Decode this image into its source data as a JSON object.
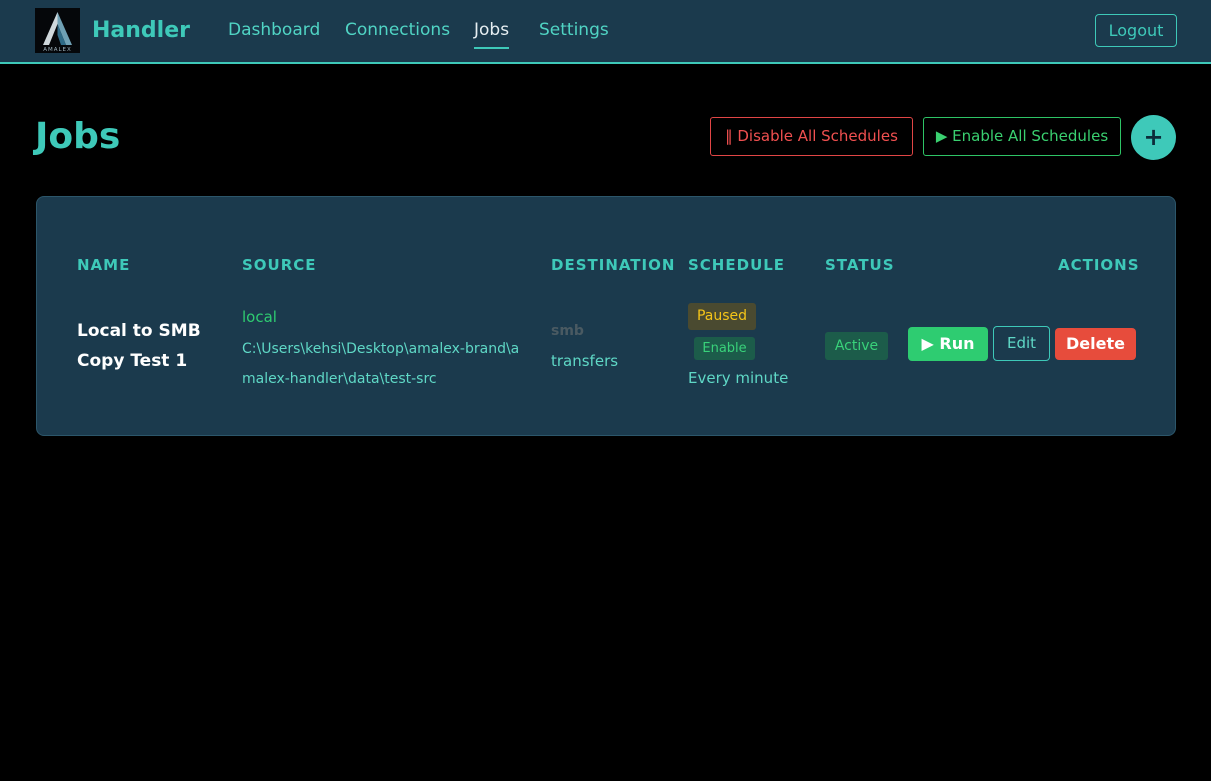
{
  "navbar": {
    "logo_text": "AMALEX",
    "brand": "Handler",
    "links": [
      {
        "label": "Dashboard"
      },
      {
        "label": "Connections"
      },
      {
        "label": "Jobs",
        "active": true
      },
      {
        "label": "Settings"
      }
    ],
    "logout_label": "Logout"
  },
  "page": {
    "title": "Jobs",
    "disable_all_icon": "pause-icon",
    "disable_all_label": "‖ Disable All Schedules",
    "enable_all_icon": "play-icon",
    "enable_all_label": "▶ Enable All Schedules",
    "add_label": "+"
  },
  "table": {
    "headers": {
      "name": "NAME",
      "source": "SOURCE",
      "destination": "DESTINATION",
      "schedule": "SCHEDULE",
      "status": "STATUS",
      "actions": "ACTIONS"
    },
    "rows": [
      {
        "name": "Local to SMB Copy Test 1",
        "source_type": "local",
        "source_path": "C:\\Users\\kehsi\\Desktop\\amalex-brand\\amalex-handler\\data\\test-src",
        "destination_type": "smb",
        "destination_path": "transfers",
        "schedule_state": "Paused",
        "schedule_toggle": "Enable",
        "schedule_interval": "Every minute",
        "status": "Active",
        "run_label": "▶ Run",
        "edit_label": "Edit",
        "delete_label": "Delete"
      }
    ]
  },
  "colors": {
    "accent": "#3ec9b9",
    "navbar_bg": "#1b3a4d",
    "page_bg": "#000000",
    "danger": "#e74c3c",
    "success": "#2ecc71",
    "warning": "#f5c518"
  }
}
